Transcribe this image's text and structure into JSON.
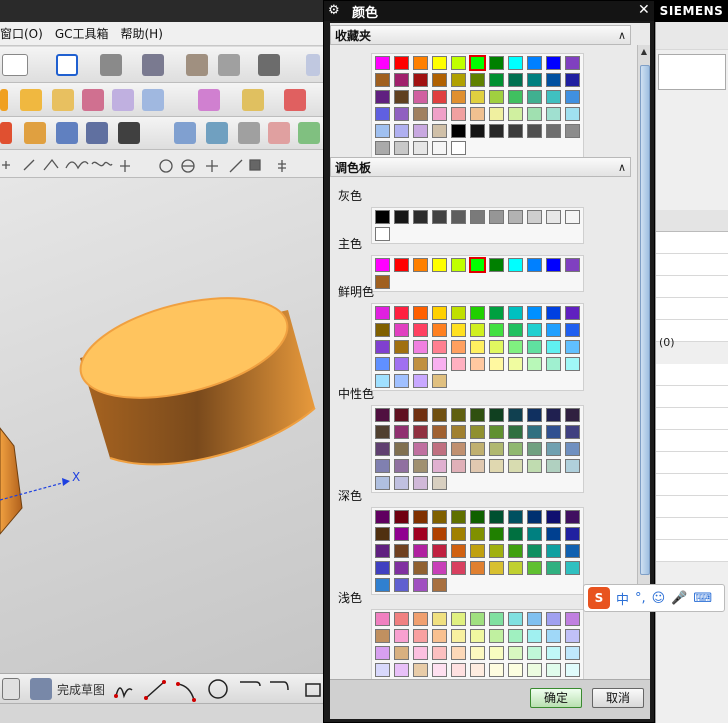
{
  "menubar": {
    "items": [
      "窗口(O)",
      "GC工具箱",
      "帮助(H)"
    ]
  },
  "background": {
    "axis_label": "X",
    "bottom_toolbar_label": "完成草图",
    "right_panel_value": "(0)",
    "brand": "SIEMENS"
  },
  "dialog": {
    "title": "颜色",
    "favorites_section": "收藏夹",
    "palette_section": "调色板",
    "collapse_glyph": "∧",
    "ok_label": "确定",
    "cancel_label": "取消",
    "favorites_colors": [
      [
        "#ff00ff",
        "#ff0000",
        "#ff8000",
        "#ffff00",
        "#c0ff00",
        "#00ff00",
        "#008000",
        "#00ffff",
        "#0080ff",
        "#0000ff",
        "#8040c0",
        "#a06020"
      ],
      [
        "#a0206c",
        "#a01010",
        "#b06000",
        "#b0a000",
        "#608000",
        "#009030",
        "#007050",
        "#008080",
        "#0050a0",
        "#2020a0",
        "#602080",
        "#604020"
      ],
      [
        "#d060a0",
        "#e04040",
        "#e09030",
        "#e0d040",
        "#a0d040",
        "#40c060",
        "#40b090",
        "#40c0c0",
        "#4090e0",
        "#6060e0",
        "#9060c0",
        "#a08060"
      ],
      [
        "#f0a0c8",
        "#f0a0a0",
        "#f0c090",
        "#f0f0a0",
        "#d0f0a0",
        "#a0e0b0",
        "#a0e0d0",
        "#a0e0f0",
        "#a0c0f0",
        "#b0b0f0",
        "#c8a8e0",
        "#d0c0a8"
      ],
      [
        "#000000",
        "#141414",
        "#282828",
        "#3c3c3c",
        "#505050",
        "#6e6e6e",
        "#8c8c8c",
        "#aaaaaa",
        "#c8c8c8",
        "#e6e6e6",
        "#f5f5f5",
        "#ffffff"
      ]
    ],
    "groups": [
      {
        "label": "灰色",
        "rows": [
          [
            "#000000",
            "#161616",
            "#2c2c2c",
            "#424242",
            "#5e5e5e",
            "#7a7a7a",
            "#969696",
            "#b2b2b2",
            "#cecece",
            "#e6e6e6",
            "#f4f4f4",
            "#ffffff"
          ]
        ]
      },
      {
        "label": "主色",
        "rows": [
          [
            "#ff00ff",
            "#ff0000",
            "#ff8000",
            "#ffff00",
            "#c0ff00",
            "#00ff00",
            "#008000",
            "#00ffff",
            "#0080ff",
            "#0000ff",
            "#8040c0",
            "#a06020"
          ]
        ],
        "selected": [
          0,
          5
        ]
      },
      {
        "label": "鲜明色",
        "rows": [
          [
            "#e020e0",
            "#ff2040",
            "#ff6000",
            "#ffd000",
            "#c0e000",
            "#20d000",
            "#00a040",
            "#00c0c0",
            "#0090ff",
            "#0040e0",
            "#6020c0",
            "#806000"
          ],
          [
            "#e040c0",
            "#ff4060",
            "#ff8020",
            "#ffe020",
            "#d0f020",
            "#40e040",
            "#20c060",
            "#20d0d0",
            "#20a0ff",
            "#2060f0",
            "#8040d0",
            "#a07010"
          ],
          [
            "#f080e0",
            "#ff8090",
            "#ffa060",
            "#fff060",
            "#e0f860",
            "#80f080",
            "#60e0a0",
            "#60f0f0",
            "#60c0ff",
            "#6090ff",
            "#a070f0",
            "#c09040"
          ],
          [
            "#f8b0f0",
            "#ffb0c0",
            "#ffc8a0",
            "#fff8a0",
            "#f0fca0",
            "#b8f8b8",
            "#a0f0d0",
            "#a0f8f8",
            "#a0e0ff",
            "#a0c0ff",
            "#c8a8ff",
            "#e0c080"
          ]
        ]
      },
      {
        "label": "中性色",
        "rows": [
          [
            "#501040",
            "#601020",
            "#703010",
            "#705010",
            "#606010",
            "#305010",
            "#104020",
            "#104050",
            "#103060",
            "#202050",
            "#302040",
            "#504030"
          ],
          [
            "#903070",
            "#903040",
            "#a06030",
            "#a08030",
            "#909030",
            "#609030",
            "#307040",
            "#307080",
            "#305090",
            "#404080",
            "#604070",
            "#807050"
          ],
          [
            "#c070a0",
            "#c07080",
            "#c09070",
            "#c0b070",
            "#b0b870",
            "#90b870",
            "#70a080",
            "#70a0b0",
            "#7090c0",
            "#8080b0",
            "#9070a0",
            "#a09070"
          ],
          [
            "#e0b0d0",
            "#e0b0b8",
            "#e0c8b0",
            "#e0d8b0",
            "#d8dcb0",
            "#c0dcb0",
            "#b0d0c0",
            "#b0d0dc",
            "#b0c0e0",
            "#c0c0e0",
            "#d0b8d8",
            "#d8cfc0"
          ]
        ]
      },
      {
        "label": "深色",
        "rows": [
          [
            "#600060",
            "#700010",
            "#803000",
            "#806000",
            "#607000",
            "#106000",
            "#005030",
            "#005060",
            "#003070",
            "#101070",
            "#401060",
            "#503010"
          ],
          [
            "#900090",
            "#a00020",
            "#b04000",
            "#a08000",
            "#809000",
            "#208000",
            "#007040",
            "#008080",
            "#004090",
            "#2020a0",
            "#602080",
            "#704020"
          ],
          [
            "#b020a0",
            "#c02040",
            "#d06010",
            "#c0a010",
            "#a0b010",
            "#40a010",
            "#109060",
            "#10a0a0",
            "#1060b0",
            "#4040c0",
            "#8030a0",
            "#906030"
          ],
          [
            "#c840b8",
            "#d84060",
            "#e08030",
            "#d8c030",
            "#c0d030",
            "#60c030",
            "#30b080",
            "#30c0c0",
            "#3080d0",
            "#6060d0",
            "#a050c0",
            "#a87040"
          ]
        ]
      },
      {
        "label": "浅色",
        "rows": [
          [
            "#f080c0",
            "#f08080",
            "#f0a070",
            "#f0e080",
            "#e0f080",
            "#a0e080",
            "#80e0a0",
            "#80e0e0",
            "#80c0f0",
            "#a0a0f0",
            "#c080e0",
            "#c09060"
          ],
          [
            "#f8a0d0",
            "#f8a0a0",
            "#f8c090",
            "#f8f0a0",
            "#f0f8a0",
            "#c0f0a0",
            "#a0f0c0",
            "#a0f0f0",
            "#a0d8f8",
            "#c0c0f8",
            "#d8a0f0",
            "#d8b080"
          ],
          [
            "#fcc0e0",
            "#fcc0c0",
            "#fcd8b8",
            "#fcf8c0",
            "#f8fcc0",
            "#d8f8c0",
            "#c0f8d8",
            "#c0f8f8",
            "#c0e8fc",
            "#d8d8fc",
            "#e8c0f8",
            "#e8cca8"
          ],
          [
            "#fee0f0",
            "#fee0e0",
            "#feece0",
            "#fefce0",
            "#fcfee0",
            "#ecfce0",
            "#e0fcec",
            "#e0fcfc",
            "#e0f4fe",
            "#ececfe",
            "#f4e0fc",
            "#f4e4d0"
          ]
        ]
      }
    ]
  },
  "ime": {
    "logo": "S",
    "mode": "中",
    "punct": "°,"
  }
}
